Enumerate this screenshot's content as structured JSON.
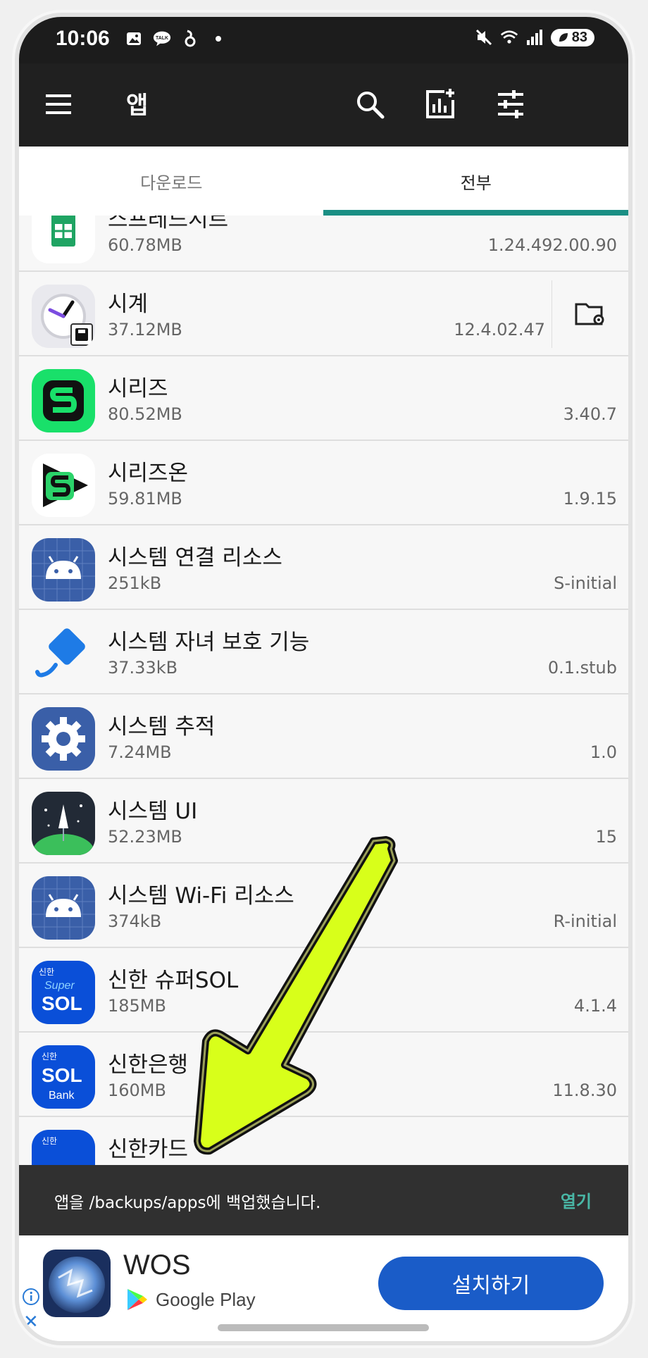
{
  "status": {
    "time": "10:06",
    "battery": "83",
    "talk_badge": "TALK"
  },
  "appbar": {
    "title": "앱"
  },
  "tabs": [
    {
      "label": "다운로드"
    },
    {
      "label": "전부"
    }
  ],
  "apps": [
    {
      "name": "스프레드시트",
      "size": "60.78MB",
      "version": "1.24.492.00.90"
    },
    {
      "name": "시계",
      "size": "37.12MB",
      "version": "12.4.02.47"
    },
    {
      "name": "시리즈",
      "size": "80.52MB",
      "version": "3.40.7"
    },
    {
      "name": "시리즈온",
      "size": "59.81MB",
      "version": "1.9.15"
    },
    {
      "name": "시스템 연결 리소스",
      "size": "251kB",
      "version": "S-initial"
    },
    {
      "name": "시스템 자녀 보호 기능",
      "size": "37.33kB",
      "version": "0.1.stub"
    },
    {
      "name": "시스템 추적",
      "size": "7.24MB",
      "version": "1.0"
    },
    {
      "name": "시스템 UI",
      "size": "52.23MB",
      "version": "15"
    },
    {
      "name": "시스템 Wi-Fi 리소스",
      "size": "374kB",
      "version": "R-initial"
    },
    {
      "name": "신한 슈퍼SOL",
      "size": "185MB",
      "version": "4.1.4"
    },
    {
      "name": "신한은행",
      "size": "160MB",
      "version": "11.8.30"
    },
    {
      "name": "신한카드",
      "size": "",
      "version": ""
    }
  ],
  "icon_text": {
    "shinhan": "신한",
    "super": "Super",
    "sol": "SOL",
    "bank": "Bank"
  },
  "snackbar": {
    "message": "앱을 /backups/apps에 백업했습니다.",
    "action": "열기"
  },
  "ad": {
    "title": "WOS",
    "store": "Google Play",
    "install": "설치하기"
  },
  "colors": {
    "accent": "#1a8f84",
    "arrow": "#d8ff1a",
    "ad_button": "#1a5cc8"
  }
}
